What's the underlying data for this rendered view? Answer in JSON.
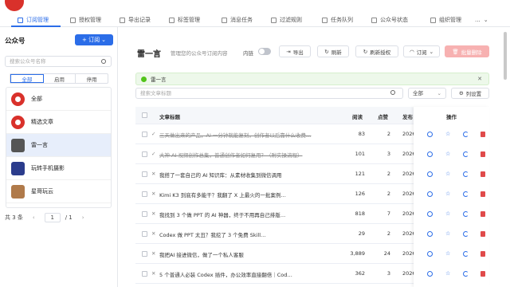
{
  "nav": {
    "tabs": [
      {
        "label": "订阅管理",
        "active": true
      },
      {
        "label": "授权管理"
      },
      {
        "label": "导出记录"
      },
      {
        "label": "标签管理"
      },
      {
        "label": "消息任务"
      },
      {
        "label": "过滤规则"
      },
      {
        "label": "任务队列"
      },
      {
        "label": "公众号状态"
      },
      {
        "label": "组织管理"
      }
    ],
    "more": "..."
  },
  "sidebar": {
    "title": "公众号",
    "subscribe_button": "+ 订阅",
    "search_placeholder": "搜索公众号名称",
    "filters": [
      "全部",
      "启用",
      "停用"
    ],
    "accounts": [
      {
        "name": "全部"
      },
      {
        "name": "精选文章"
      },
      {
        "name": "雷一言",
        "selected": true
      },
      {
        "name": "玩转手机摄影"
      },
      {
        "name": "星哥玩云"
      }
    ],
    "pager": {
      "total": "共 3 条",
      "page": "1",
      "of": "/ 1"
    }
  },
  "main": {
    "account_title": "雷一言",
    "description": "管理您的公众号订阅内容",
    "inner_label": "内链",
    "buttons": {
      "export": "导出",
      "refresh": "刷新",
      "refresh_auth": "刷新授权",
      "subscribe": "订阅",
      "delete_subscription": "批量删除"
    },
    "alert_text": "雷一言",
    "search_placeholder": "搜索文章标题",
    "filter_select": "全部",
    "column_settings": "列设置"
  },
  "table": {
    "headers": {
      "title": "文章标题",
      "reads": "阅读",
      "likes": "点赞",
      "published": "发布",
      "ops": "操作"
    },
    "rows": [
      {
        "title": "三天做出来的产品，AI 一分钟就能复刻，创作者以后靠什么收费…",
        "reads": "83",
        "likes": "2",
        "date": "2026-",
        "strike": true,
        "status": "✓"
      },
      {
        "title": "大神 AI 视频创作总集，普通创作者如何复用？（附实操流程）",
        "reads": "101",
        "likes": "3",
        "date": "2026-",
        "strike": true,
        "status": "✓"
      },
      {
        "title": "我搭了一套自己的 AI 知识库：从素材收集到微信调用",
        "reads": "121",
        "likes": "2",
        "date": "2026-",
        "status": "✕"
      },
      {
        "title": "Kimi K3 到底有多能干？我翻了 X 上最火的一批案例…",
        "reads": "126",
        "likes": "2",
        "date": "2026-",
        "status": "✕"
      },
      {
        "title": "我找到 3 个做 PPT 的 AI 神器，终于不用再自己排版…",
        "reads": "818",
        "likes": "7",
        "date": "2026-",
        "status": "✕"
      },
      {
        "title": "Codex 做 PPT 太丑？我挖了 3 个免费 Skill…",
        "reads": "29",
        "likes": "2",
        "date": "2026-",
        "status": "✕"
      },
      {
        "title": "我把AI 接进微信，做了一个私人客服",
        "reads": "3,889",
        "likes": "24",
        "date": "2026-",
        "status": "✕"
      },
      {
        "title": "5 个普通人必装 Codex 插件，办公效率直接翻倍｜Cod…",
        "reads": "362",
        "likes": "3",
        "date": "2026-",
        "status": "✕"
      }
    ]
  },
  "colors": {
    "primary": "#2b6de8",
    "danger": "#e04a4a",
    "success": "#52c41a",
    "brand": "#d9312b"
  }
}
